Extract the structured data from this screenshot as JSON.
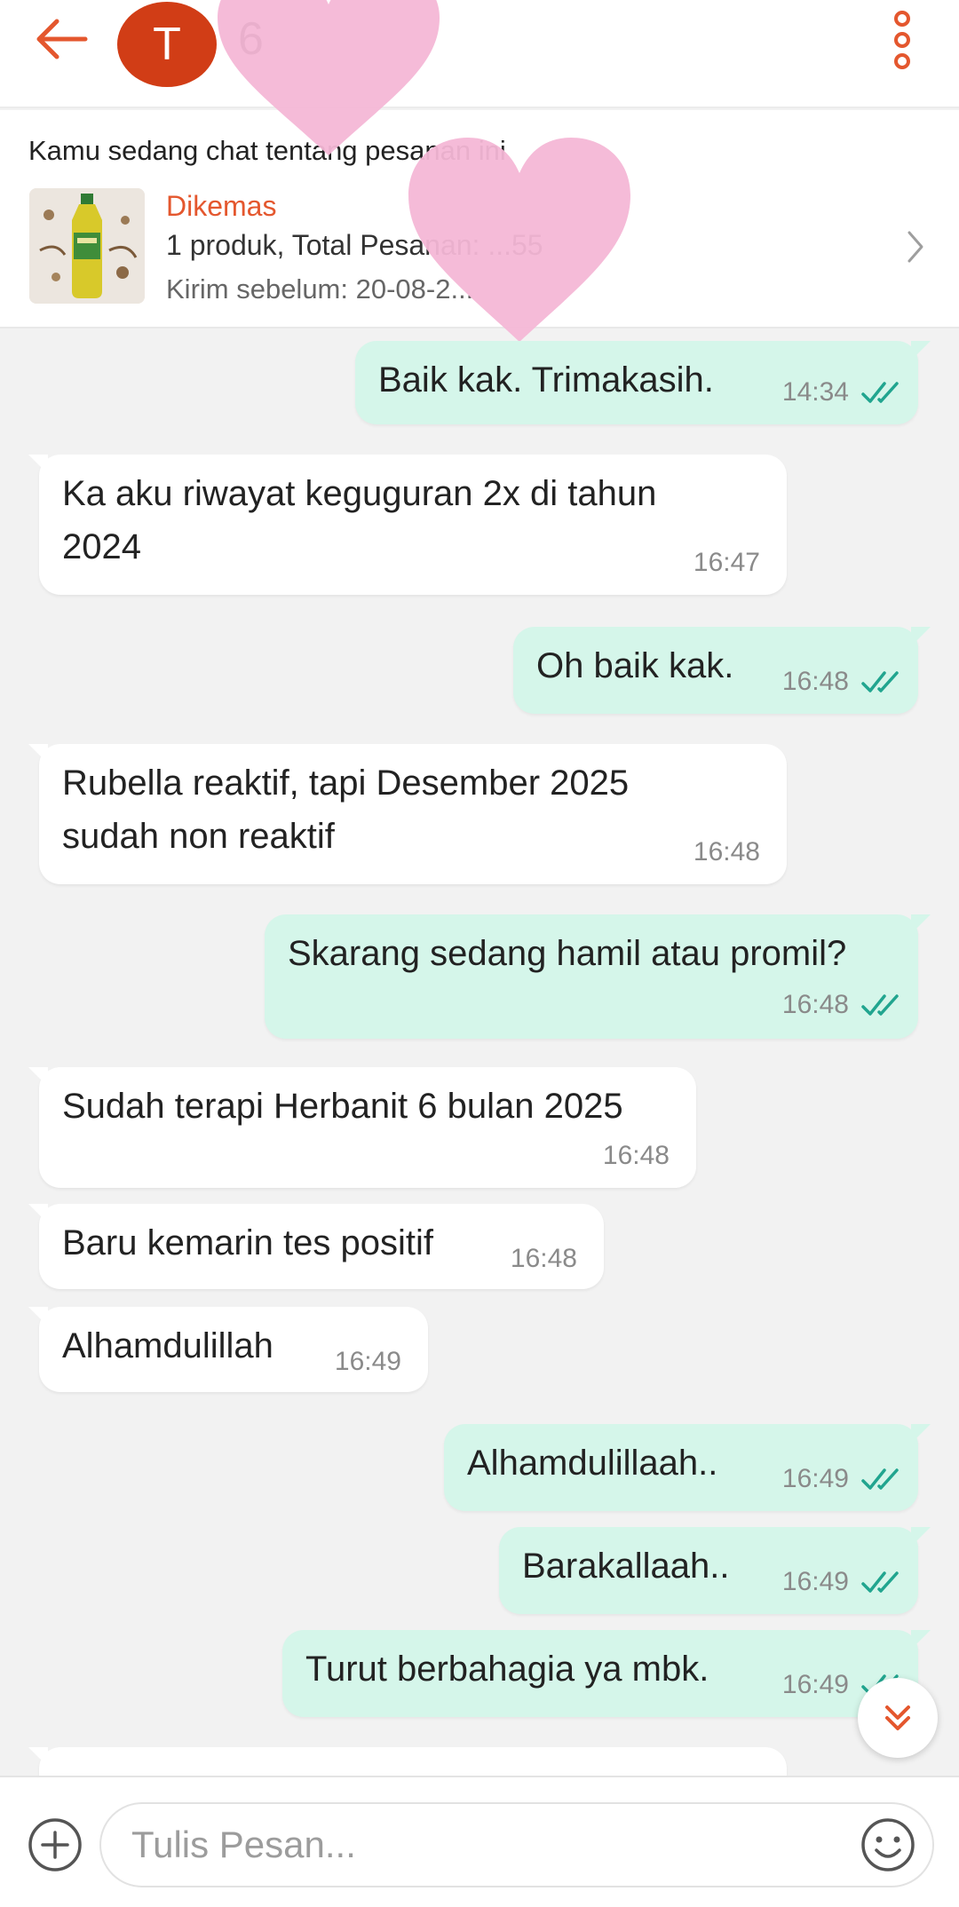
{
  "header": {
    "avatar_letter": "T",
    "title": "6"
  },
  "banner": {
    "caption": "Kamu sedang chat tentang pesanan ini",
    "status": "Dikemas",
    "summary": "1 produk, Total Pesanan: ...55",
    "deadline": "Kirim sebelum: 20-08-2..."
  },
  "messages": [
    {
      "dir": "out",
      "lines": [
        "Baik kak. Trimakasih."
      ],
      "time": "14:34"
    },
    {
      "dir": "in",
      "lines": [
        "Ka aku riwayat keguguran 2x di tahun",
        "2024"
      ],
      "time": "16:47"
    },
    {
      "dir": "out",
      "lines": [
        "Oh baik kak."
      ],
      "time": "16:48"
    },
    {
      "dir": "in",
      "lines": [
        "Rubella reaktif, tapi Desember 2025",
        "sudah non reaktif"
      ],
      "time": "16:48"
    },
    {
      "dir": "out",
      "lines": [
        "Skarang sedang hamil atau promil?"
      ],
      "time": "16:48"
    },
    {
      "dir": "in",
      "lines": [
        "Sudah terapi Herbanit 6 bulan 2025"
      ],
      "time": "16:48"
    },
    {
      "dir": "in",
      "lines": [
        "Baru kemarin tes positif"
      ],
      "time": "16:48"
    },
    {
      "dir": "in",
      "lines": [
        "Alhamdulillah"
      ],
      "time": "16:49"
    },
    {
      "dir": "out",
      "lines": [
        "Alhamdulillaah.."
      ],
      "time": "16:49"
    },
    {
      "dir": "out",
      "lines": [
        "Barakallaah.."
      ],
      "time": "16:49"
    },
    {
      "dir": "out",
      "lines": [
        "Turut berbahagia ya mbk."
      ],
      "time": "16:49"
    }
  ],
  "input": {
    "placeholder": "Tulis Pesan..."
  },
  "icons": {
    "back": "back-arrow-icon",
    "more": "more-vertical-icon",
    "chevron": "chevron-right-icon",
    "read": "double-check-icon",
    "scroll": "chevron-double-down-icon",
    "add": "add-circle-icon",
    "emoji": "emoji-icon"
  },
  "colors": {
    "accent": "#e4572e",
    "avatar": "#d13d16",
    "outgoing_bubble": "#d5f6ea",
    "incoming_bubble": "#ffffff",
    "read_tick": "#21a58f",
    "background": "#f2f2f2"
  }
}
